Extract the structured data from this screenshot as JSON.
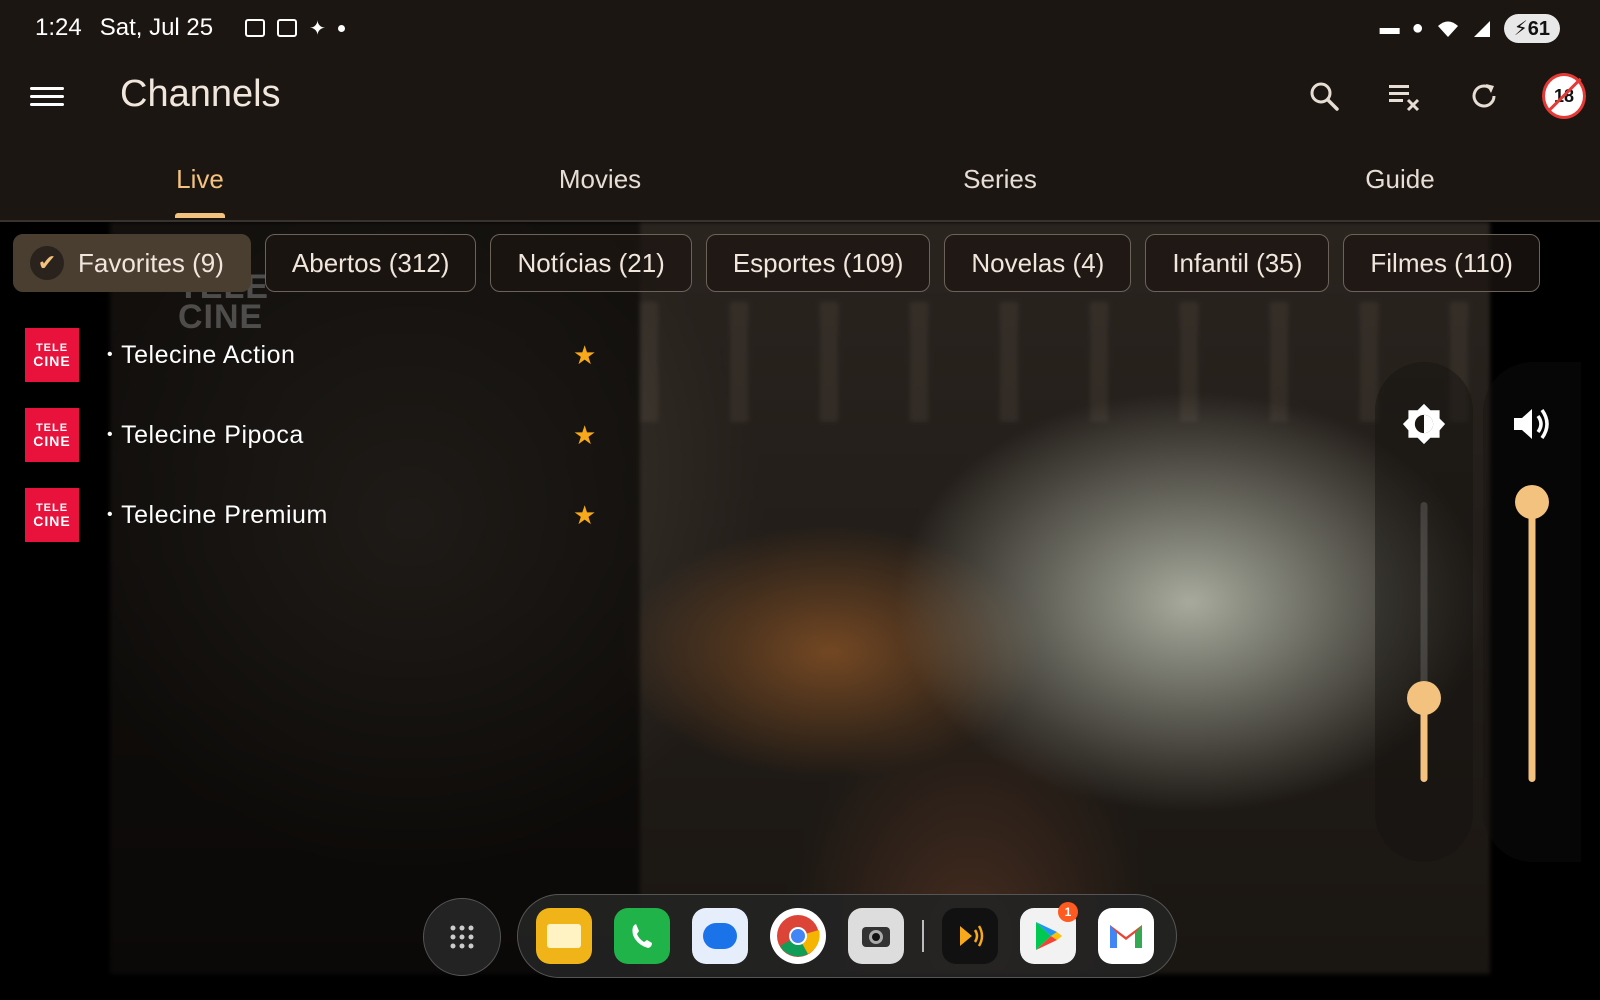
{
  "status_bar": {
    "time": "1:24",
    "date": "Sat, Jul 25",
    "battery": "61",
    "icons_left": [
      "notification-icon",
      "calendar-icon",
      "accessibility-icon",
      "dot-icon"
    ],
    "icons_right": [
      "bed-icon",
      "location-icon",
      "wifi-icon",
      "signal-icon",
      "battery-icon"
    ]
  },
  "app_bar": {
    "title": "Channels",
    "parental_badge": "18"
  },
  "tabs": [
    {
      "label": "Live",
      "active": true
    },
    {
      "label": "Movies",
      "active": false
    },
    {
      "label": "Series",
      "active": false
    },
    {
      "label": "Guide",
      "active": false
    }
  ],
  "categories": [
    {
      "label": "Favorites (9)",
      "selected": true
    },
    {
      "label": "Abertos (312)",
      "selected": false
    },
    {
      "label": "Notícias (21)",
      "selected": false
    },
    {
      "label": "Esportes (109)",
      "selected": false
    },
    {
      "label": "Novelas (4)",
      "selected": false
    },
    {
      "label": "Infantil (35)",
      "selected": false
    },
    {
      "label": "Filmes (110)",
      "selected": false
    }
  ],
  "channels": [
    {
      "name": "Telecine Action",
      "logo_top": "TELE",
      "logo_bottom": "CINE",
      "favorite": true
    },
    {
      "name": "Telecine Pipoca",
      "logo_top": "TELE",
      "logo_bottom": "CINE",
      "favorite": true
    },
    {
      "name": "Telecine Premium",
      "logo_top": "TELE",
      "logo_bottom": "CINE",
      "favorite": true
    }
  ],
  "video_watermark": {
    "line1": "TELE",
    "line2": "CINE"
  },
  "brightness": {
    "level": 0.3
  },
  "volume": {
    "level": 1.0
  },
  "dock": {
    "play_store_badge": "1",
    "apps": [
      "files-app",
      "phone-app",
      "messages-app",
      "chrome-app",
      "camera-app",
      "audio-app",
      "play-store-app",
      "gmail-app"
    ]
  },
  "colors": {
    "accent": "#f2c27e",
    "star": "#f7a81b",
    "telecine": "#e8123c"
  }
}
